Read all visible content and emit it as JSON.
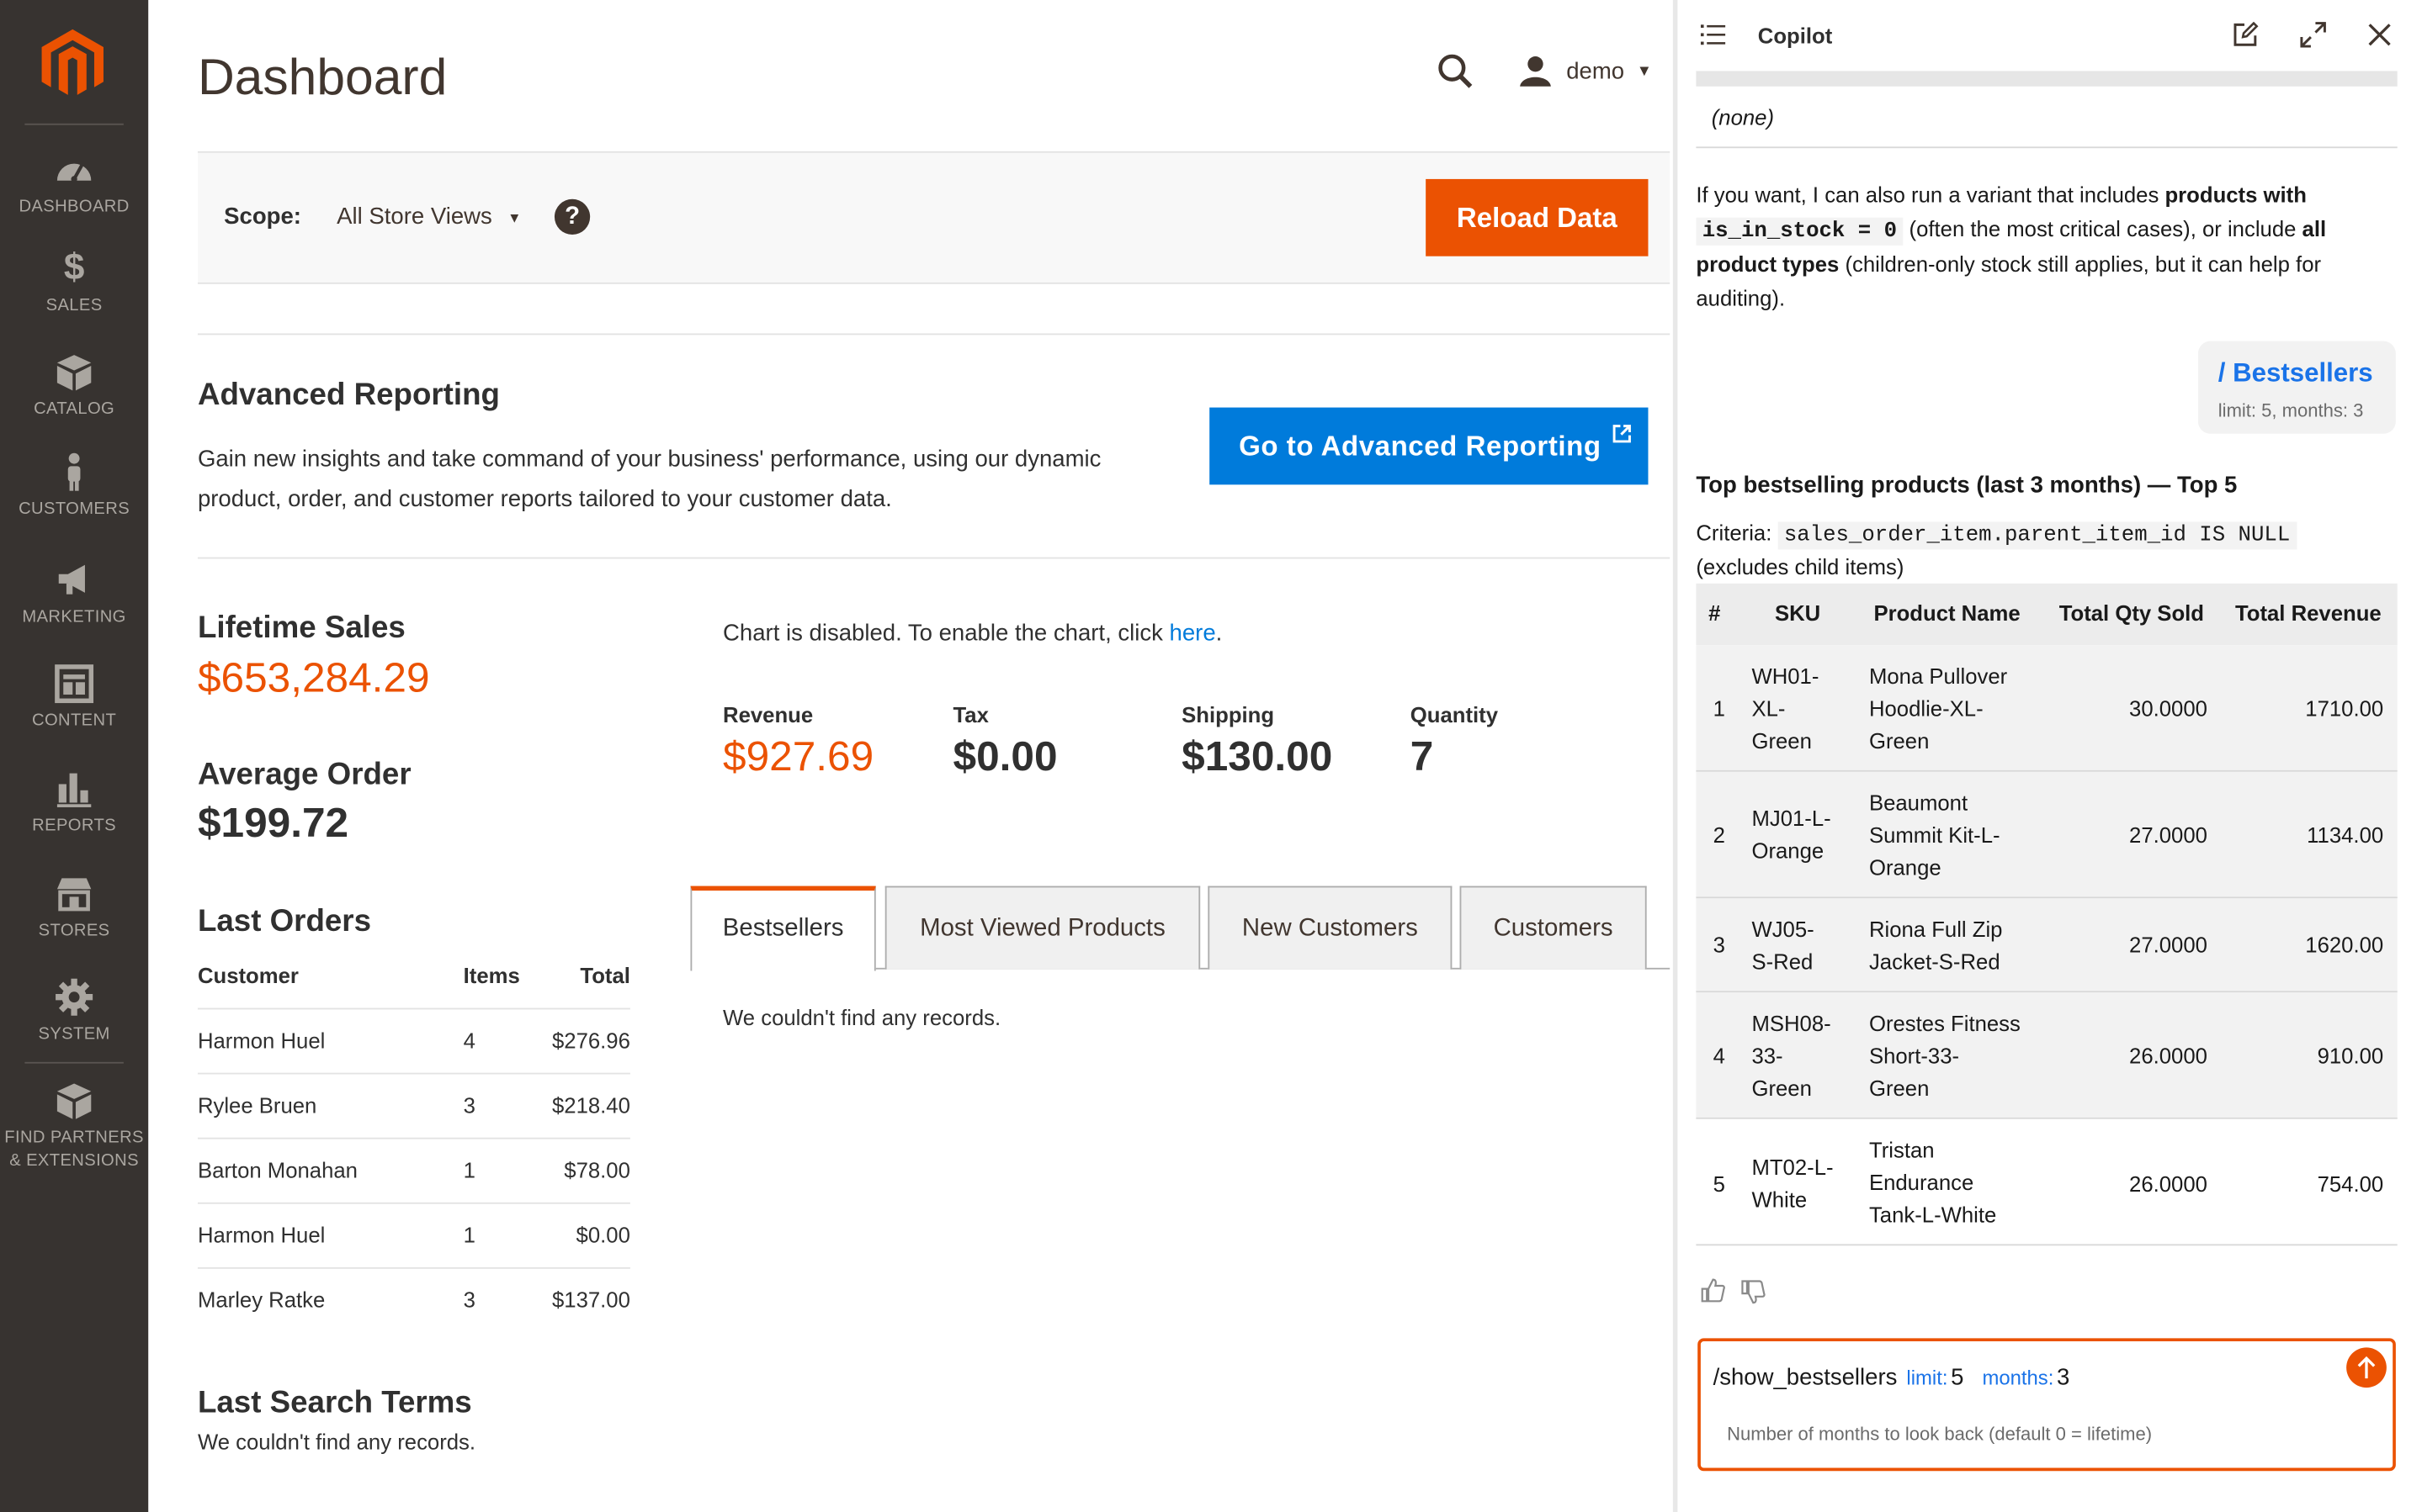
{
  "sidebar": {
    "items": [
      {
        "label": "DASHBOARD",
        "icon": "dashboard-icon"
      },
      {
        "label": "SALES",
        "icon": "dollar-icon"
      },
      {
        "label": "CATALOG",
        "icon": "box-icon"
      },
      {
        "label": "CUSTOMERS",
        "icon": "person-icon"
      },
      {
        "label": "MARKETING",
        "icon": "megaphone-icon"
      },
      {
        "label": "CONTENT",
        "icon": "layout-icon"
      },
      {
        "label": "REPORTS",
        "icon": "bar-chart-icon"
      },
      {
        "label": "STORES",
        "icon": "store-icon"
      },
      {
        "label": "SYSTEM",
        "icon": "gear-icon"
      }
    ],
    "partners_label_1": "FIND PARTNERS",
    "partners_label_2": "& EXTENSIONS"
  },
  "header": {
    "title": "Dashboard",
    "user": "demo"
  },
  "scope": {
    "label": "Scope:",
    "value": "All Store Views",
    "reload_button": "Reload Data"
  },
  "advanced": {
    "title": "Advanced Reporting",
    "text_line1": "Gain new insights and take command of your business' performance, using our dynamic",
    "text_line2": "product, order, and customer reports tailored to your customer data.",
    "button": "Go to Advanced Reporting"
  },
  "stats": {
    "lifetime_label": "Lifetime Sales",
    "lifetime_value": "$653,284.29",
    "average_label": "Average Order",
    "average_value": "$199.72"
  },
  "chart_notice": {
    "text": "Chart is disabled. To enable the chart, click ",
    "link": "here",
    "end": "."
  },
  "totals": [
    {
      "label": "Revenue",
      "value": "$927.69"
    },
    {
      "label": "Tax",
      "value": "$0.00"
    },
    {
      "label": "Shipping",
      "value": "$130.00"
    },
    {
      "label": "Quantity",
      "value": "7"
    }
  ],
  "last_orders": {
    "title": "Last Orders",
    "headers": [
      "Customer",
      "Items",
      "Total"
    ],
    "rows": [
      [
        "Harmon Huel",
        "4",
        "$276.96"
      ],
      [
        "Rylee Bruen",
        "3",
        "$218.40"
      ],
      [
        "Barton Monahan",
        "1",
        "$78.00"
      ],
      [
        "Harmon Huel",
        "1",
        "$0.00"
      ],
      [
        "Marley Ratke",
        "3",
        "$137.00"
      ]
    ]
  },
  "tabs": [
    "Bestsellers",
    "Most Viewed Products",
    "New Customers",
    "Customers"
  ],
  "tab_empty": "We couldn't find any records.",
  "search_terms": {
    "title": "Last Search Terms",
    "empty": "We couldn't find any records."
  },
  "copilot": {
    "title": "Copilot",
    "none_text": "(none)",
    "msg_p1": "If you want, I can also run a variant that includes ",
    "msg_b1": "products with",
    "msg_code": "is_in_stock = 0",
    "msg_p2": " (often the most critical cases), or include ",
    "msg_b2": "all",
    "msg_b3": "product types",
    "msg_p3": " (children-only stock still applies, but it can help for",
    "msg_p4": "auditing).",
    "chip_title": "/ Bestsellers",
    "chip_sub": "limit: 5, months: 3",
    "result_title": "Top bestselling products (last 3 months) — Top 5",
    "criteria_label": "Criteria:",
    "criteria_code": "sales_order_item.parent_item_id IS NULL",
    "criteria_note": "(excludes child items)",
    "table_headers": [
      "#",
      "SKU",
      "Product Name",
      "Total Qty Sold",
      "Total Revenue"
    ],
    "rows": [
      {
        "n": "1",
        "sku": [
          "WH01-",
          "XL-",
          "Green"
        ],
        "name": [
          "Mona Pullover",
          "Hoodlie-XL-",
          "Green"
        ],
        "qty": "30.0000",
        "rev": "1710.00"
      },
      {
        "n": "2",
        "sku": [
          "MJ01-L-",
          "Orange"
        ],
        "name": [
          "Beaumont",
          "Summit Kit-L-",
          "Orange"
        ],
        "qty": "27.0000",
        "rev": "1134.00"
      },
      {
        "n": "3",
        "sku": [
          "WJ05-",
          "S-Red"
        ],
        "name": [
          "Riona Full Zip",
          "Jacket-S-Red"
        ],
        "qty": "27.0000",
        "rev": "1620.00"
      },
      {
        "n": "4",
        "sku": [
          "MSH08-",
          "33-",
          "Green"
        ],
        "name": [
          "Orestes Fitness",
          "Short-33-",
          "Green"
        ],
        "qty": "26.0000",
        "rev": "910.00"
      },
      {
        "n": "5",
        "sku": [
          "MT02-L-",
          "White"
        ],
        "name": [
          "Tristan",
          "Endurance",
          "Tank-L-White"
        ],
        "qty": "26.0000",
        "rev": "754.00"
      }
    ],
    "input_command": "/show_bestsellers",
    "input_limit_label": "limit:",
    "input_limit_value": "5",
    "input_months_label": "months:",
    "input_months_value": "3",
    "input_hint": "Number of months to look back (default 0 = lifetime)"
  }
}
